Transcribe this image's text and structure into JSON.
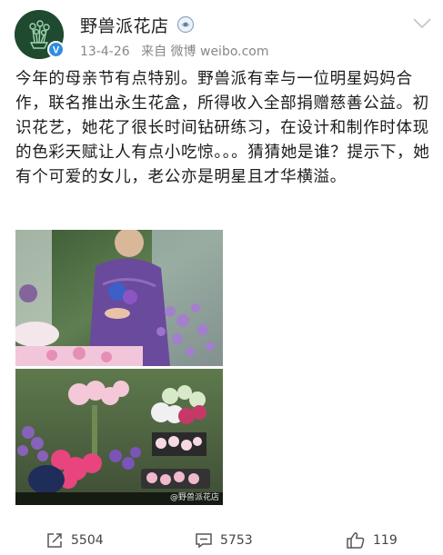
{
  "post": {
    "account_name": "野兽派花店",
    "timestamp": "13-4-26",
    "source": "来自 微博 weibo.com",
    "text": "今年的母亲节有点特别。野兽派有幸与一位明星妈妈合作，联名推出永生花盒，所得收入全部捐赠慈善公益。初识花艺，她花了很长时间钻研练习，在设计和制作时体现的色彩天赋让人有点小吃惊。。。猜猜她是谁？提示下，她有个可爱的女儿，老公亦是明星且才华横溢。",
    "watermark": "@野兽派花店"
  },
  "actions": {
    "repost_count": "5504",
    "comment_count": "5753",
    "like_count": "119"
  },
  "icons": {
    "verified": "verified-badge-icon",
    "vip": "vip-badge-icon",
    "menu": "chevron-down-icon",
    "repost": "repost-icon",
    "comment": "comment-icon",
    "like": "thumbs-up-icon"
  },
  "colors": {
    "verified_blue": "#2f8ee0",
    "avatar_green": "#1f4a2f",
    "meta_gray": "#888888"
  }
}
